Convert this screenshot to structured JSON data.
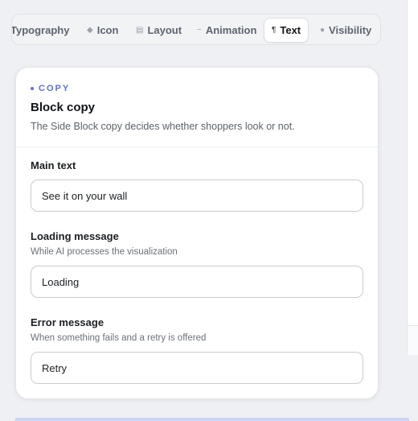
{
  "tabs": [
    {
      "label": "Typography",
      "icon": "typography-icon"
    },
    {
      "label": "Icon",
      "icon": "diamond-icon",
      "glyph": "◆"
    },
    {
      "label": "Layout",
      "icon": "layout-icon",
      "glyph": "▤"
    },
    {
      "label": "Animation",
      "icon": "animation-icon",
      "glyph": "~"
    },
    {
      "label": "Text",
      "icon": "pilcrow-icon",
      "glyph": "¶",
      "active": true
    },
    {
      "label": "Visibility",
      "icon": "visibility-icon",
      "glyph": "●"
    }
  ],
  "card": {
    "eyebrow": "COPY",
    "title": "Block copy",
    "description": "The Side Block copy decides whether shoppers look or not."
  },
  "fields": {
    "main": {
      "label": "Main text",
      "value": "See it on your wall"
    },
    "loading": {
      "label": "Loading message",
      "help": "While AI processes the visualization",
      "value": "Loading"
    },
    "error": {
      "label": "Error message",
      "help": "When something fails and a retry is offered",
      "value": "Retry"
    }
  },
  "colors": {
    "accent": "#5b6ee1",
    "page_bg": "#eef0f3",
    "card_bg": "#ffffff"
  }
}
